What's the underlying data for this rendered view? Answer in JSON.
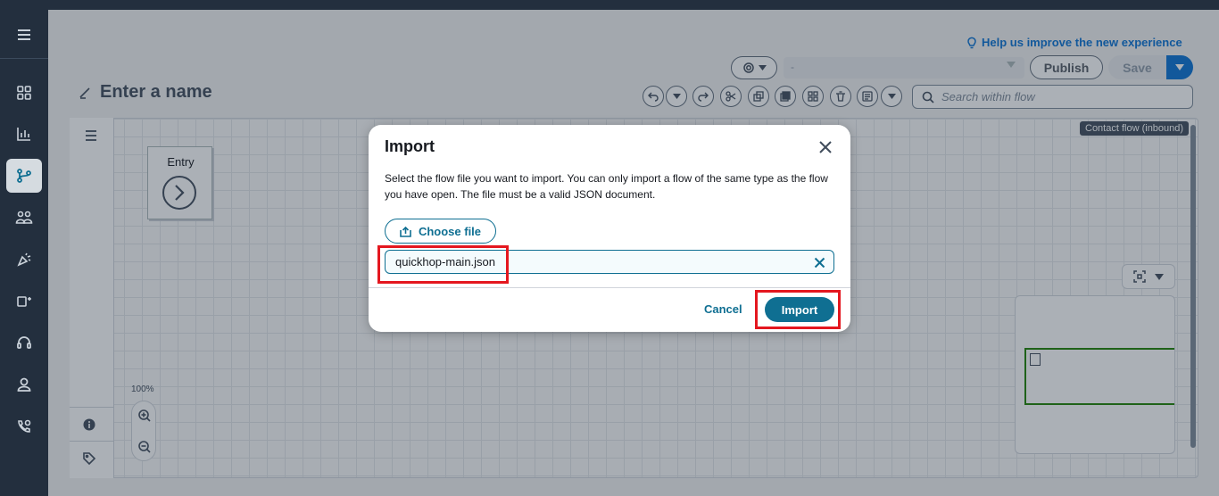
{
  "help_link": "Help us improve the new experience",
  "header": {
    "version_placeholder": "-",
    "publish_label": "Publish",
    "save_label": "Save",
    "flow_name_placeholder": "Enter a name",
    "search_placeholder": "Search within flow"
  },
  "canvas": {
    "flow_type_badge": "Contact flow (inbound)",
    "entry_block_label": "Entry",
    "zoom_level": "100%"
  },
  "sidebar_icons": [
    "menu-icon",
    "dashboard-icon",
    "analytics-icon",
    "routing-icon",
    "users-icon",
    "campaigns-icon",
    "channels-icon",
    "headset-icon",
    "user-icon",
    "phone-icon"
  ],
  "dialog": {
    "title": "Import",
    "description": "Select the flow file you want to import. You can only import a flow of the same type as the flow you have open. The file must be a valid JSON document.",
    "choose_file_label": "Choose file",
    "file_name": "quickhop-main.json",
    "cancel_label": "Cancel",
    "import_label": "Import"
  },
  "colors": {
    "nav_bg": "#232f3e",
    "accent": "#0f6f92",
    "link": "#0972d3",
    "highlight": "#e4171f"
  }
}
